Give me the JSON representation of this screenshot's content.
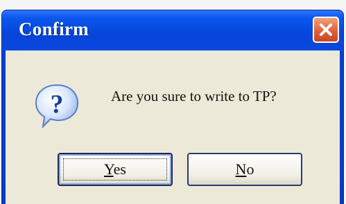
{
  "dialog": {
    "title": "Confirm",
    "message": "Are you sure to write to TP?",
    "icon": "question-icon",
    "buttons": {
      "yes": {
        "mnemonic": "Y",
        "rest": "es"
      },
      "no": {
        "mnemonic": "N",
        "rest": "o"
      }
    }
  },
  "colors": {
    "titlebar": "#0a4de0",
    "client_bg": "#ece9d8",
    "close_button": "#e0603a"
  }
}
